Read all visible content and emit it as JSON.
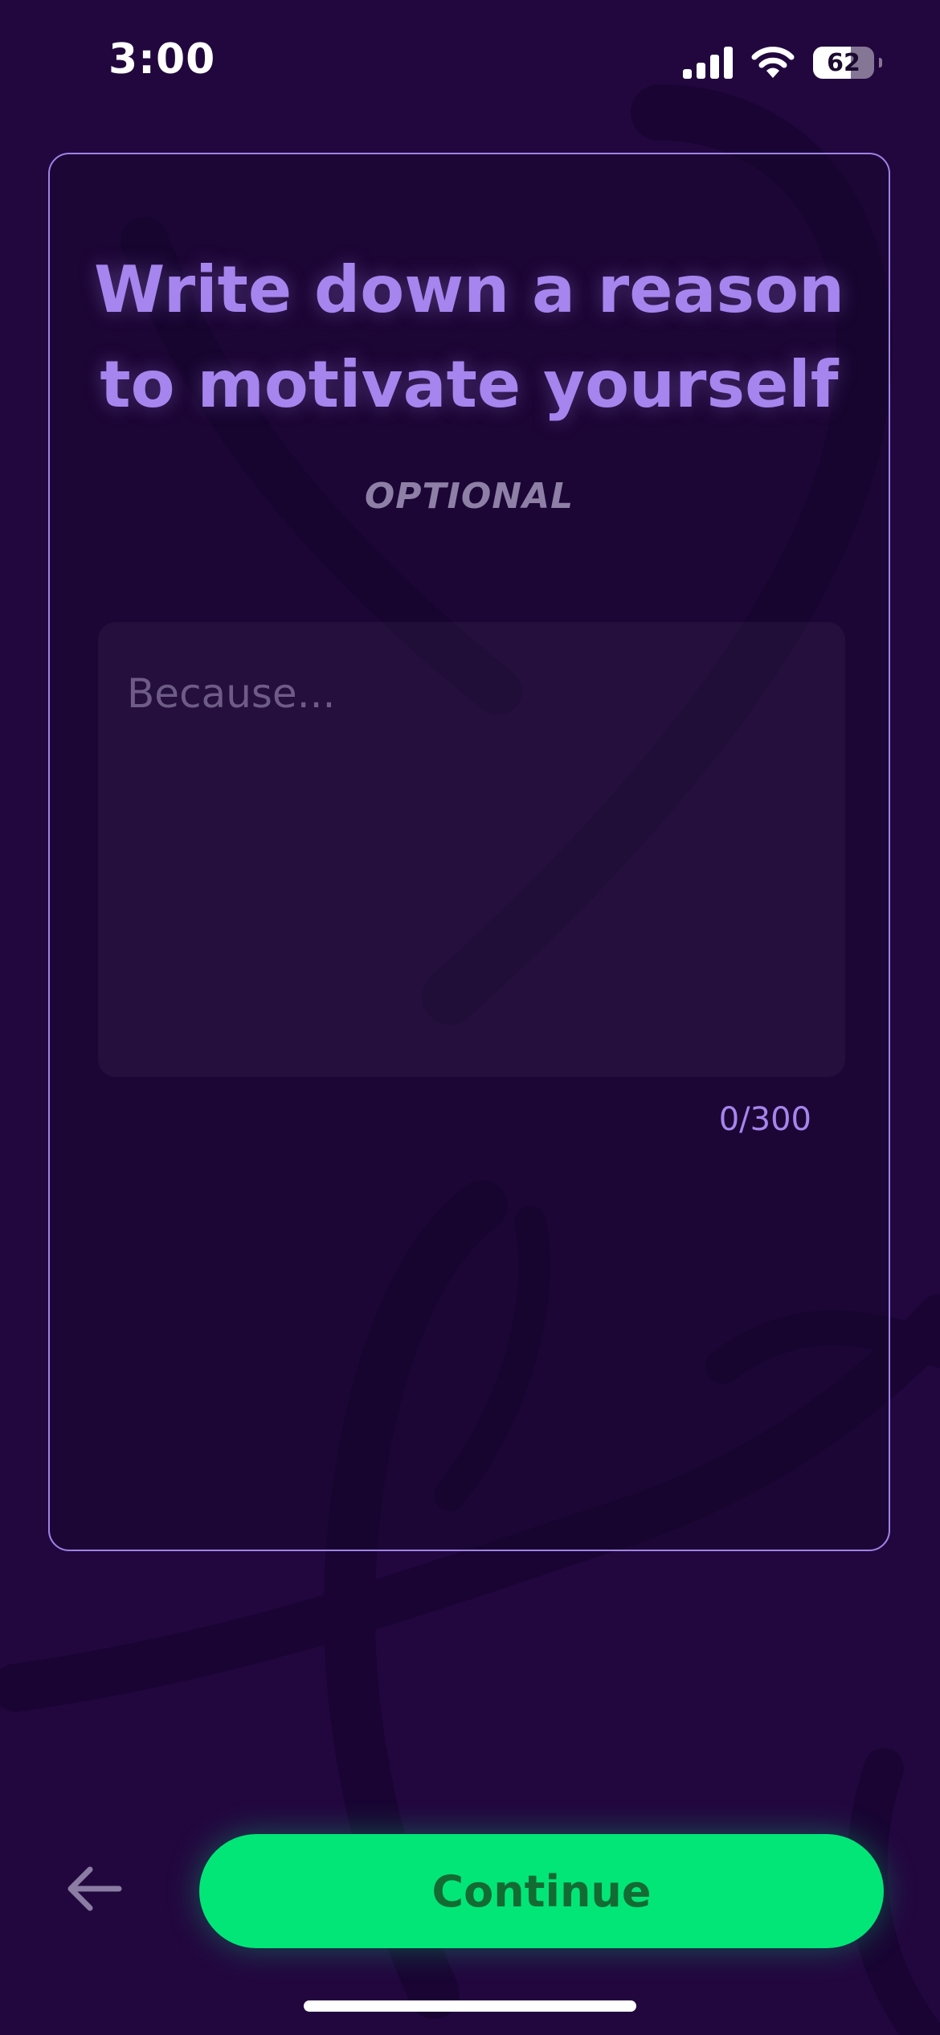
{
  "status_bar": {
    "time": "3:00",
    "battery_level": "62"
  },
  "prompt": {
    "title": "Write down a reason to motivate yourself",
    "subtitle": "OPTIONAL"
  },
  "reason_input": {
    "value": "",
    "placeholder": "Because...",
    "counter": "0/300"
  },
  "footer": {
    "back_icon": "arrow-left-icon",
    "continue_label": "Continue"
  },
  "colors": {
    "background": "#22073f",
    "accent": "#a685ee",
    "primary_button": "#02e678",
    "primary_button_text": "#136b33"
  }
}
